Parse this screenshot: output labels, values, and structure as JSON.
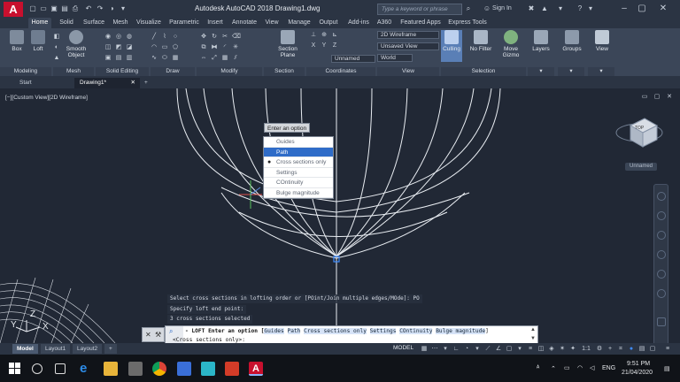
{
  "titlebar": {
    "logo": "A",
    "title": "Autodesk AutoCAD 2018    Drawing1.dwg",
    "search_placeholder": "Type a keyword or phrase",
    "sign_in": "Sign In"
  },
  "ribbon_tabs": [
    "Home",
    "Solid",
    "Surface",
    "Mesh",
    "Visualize",
    "Parametric",
    "Insert",
    "Annotate",
    "View",
    "Manage",
    "Output",
    "Add-ins",
    "A360",
    "Featured Apps",
    "Express Tools"
  ],
  "ribbon": {
    "box": "Box",
    "loft": "Loft",
    "smooth_object": "Smooth Object",
    "section_plane": "Section Plane",
    "visual_style": "2D Wireframe",
    "saved_view": "Unsaved View",
    "unnamed": "Unnamed",
    "world": "World",
    "culling": "Culling",
    "no_filter": "No Filter",
    "move_gizmo": "Move Gizmo",
    "layers": "Layers",
    "groups": "Groups",
    "view": "View",
    "panels": [
      "Modeling",
      "Mesh",
      "Solid Editing",
      "Draw",
      "Modify",
      "Section",
      "Coordinates",
      "View",
      "Selection"
    ]
  },
  "doc_tabs": {
    "start": "Start",
    "drawing": "Drawing1*"
  },
  "viewport": {
    "label": "[−][Custom View][2D Wireframe]",
    "viewcube_top": "TOP",
    "unnamed": "Unnamed"
  },
  "option_menu": {
    "title": "Enter an option",
    "items": [
      "Guides",
      "Path",
      "Cross sections only",
      "Settings",
      "COntinuity",
      "Bulge magnitude"
    ]
  },
  "command_history": [
    "Select cross sections in lofting order or [POint/Join multiple edges/MOde]: PO",
    "Specify loft end point:",
    "3 cross sections selected"
  ],
  "command_line": {
    "prefix": "- LOFT Enter an option [",
    "options": [
      "Guides",
      "Path",
      "Cross sections only",
      "Settings",
      "COntinuity",
      "Bulge magnitude"
    ],
    "suffix": "]",
    "prompt": "<Cross sections only>:"
  },
  "layout_tabs": [
    "Model",
    "Layout1",
    "Layout2"
  ],
  "statusbar": {
    "model": "MODEL",
    "scale": "1:1"
  },
  "taskbar": {
    "lang": "ENG",
    "time": "9:51 PM",
    "date": "21/04/2020"
  },
  "colors": {
    "accent_blue": "#2f6cc8",
    "autocad_red": "#c8102e",
    "viewport_bg": "#212835",
    "ribbon_bg": "#3b4658"
  }
}
